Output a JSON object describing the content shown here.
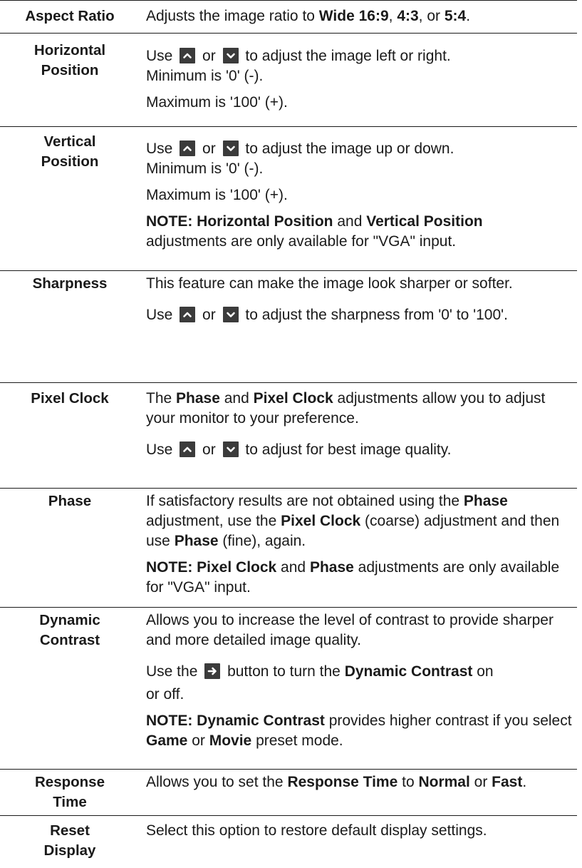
{
  "rows": [
    {
      "label": "Aspect Ratio",
      "p1": {
        "a": "Adjusts the image ratio to ",
        "b1": "Wide 16:9",
        "c": ", ",
        "b2": "4:3",
        "d": ", or ",
        "b3": "5:4",
        "e": "."
      }
    },
    {
      "label_1": "Horizontal",
      "label_2": "Position",
      "use": "Use",
      "or": "or",
      "tail": "to adjust the image left or right.",
      "min": "Minimum is '0' (-).",
      "max": "Maximum is '100' (+)."
    },
    {
      "label_1": "Vertical",
      "label_2": "Position",
      "use": "Use",
      "or": "or",
      "tail": "to adjust the image up or down.",
      "min": "Minimum is '0' (-).",
      "max": "Maximum is '100' (+).",
      "note": {
        "b1": "NOTE: Horizontal Position",
        "a": " and ",
        "b2": "Vertical Position",
        "c": "adjustments are only available for \"VGA\" input."
      }
    },
    {
      "label": "Sharpness",
      "p1": "This feature can make the image look sharper or softer.",
      "use": "Use",
      "or": "or",
      "tail": "to adjust the sharpness from '0' to '100'."
    },
    {
      "label": "Pixel Clock",
      "p1": {
        "a": "The ",
        "b1": "Phase",
        "c": " and ",
        "b2": "Pixel Clock",
        "d": " adjustments allow you to adjust your monitor to your preference."
      },
      "use": "Use",
      "or": "or",
      "tail": "to adjust for best image quality."
    },
    {
      "label": "Phase",
      "p1": {
        "a": "If satisfactory results are not obtained using the ",
        "b1": "Phase",
        "c": " adjustment, use the ",
        "b2": "Pixel Clock",
        "d": " (coarse) adjustment and then use ",
        "b3": "Phase",
        "e": " (fine), again."
      },
      "note": {
        "b1": "NOTE: Pixel Clock",
        "a": " and ",
        "b2": "Phase",
        "c": " adjustments are only available for \"VGA\" input."
      }
    },
    {
      "label_1": "Dynamic",
      "label_2": "Contrast",
      "p1": "Allows you to increase the level of contrast to provide sharper and more detailed image quality.",
      "p2": {
        "a": "Use the",
        "b": "button to turn the ",
        "c": "Dynamic Contrast",
        "d": " on",
        "e": "or off."
      },
      "note": {
        "b1": "NOTE: Dynamic Contrast",
        "a": " provides higher contrast if you select ",
        "b2": "Game",
        "c": " or ",
        "b3": "Movie",
        "d": " preset mode."
      }
    },
    {
      "label_1": "Response",
      "label_2": "Time",
      "p1": {
        "a": "Allows you to set the ",
        "b1": "Response Time",
        "c": " to ",
        "b2": "Normal",
        "d": " or ",
        "b3": "Fast",
        "e": "."
      }
    },
    {
      "label_1": "Reset",
      "label_2": "Display",
      "p1": "Select this option to restore default display settings."
    }
  ],
  "icons": [
    "up-button-icon",
    "down-button-icon",
    "right-arrow-button-icon"
  ],
  "colors": {
    "text": "#1a1a1a",
    "icon_bg": "#3b3b3b",
    "icon_fg": "#ffffff",
    "rule": "#1a1a1a"
  }
}
